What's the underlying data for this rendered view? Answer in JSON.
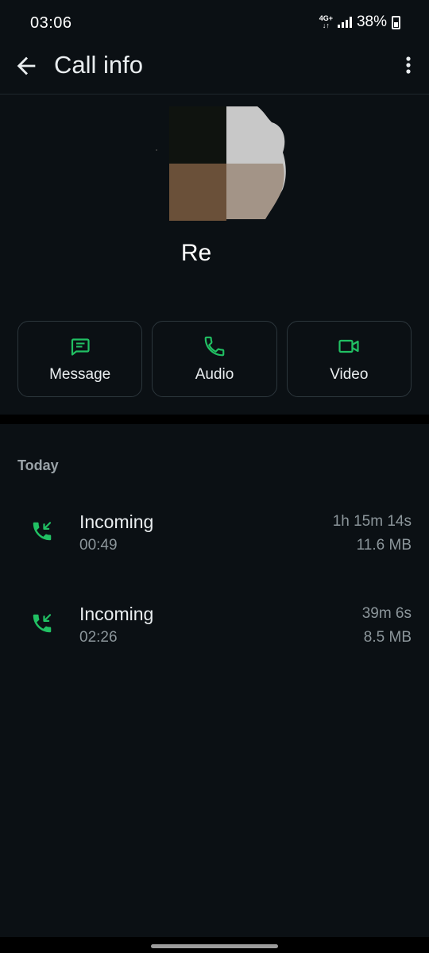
{
  "status_bar": {
    "time": "03:06",
    "network_top": "4G+",
    "network_bottom": "↓↑",
    "battery": "38%"
  },
  "app_bar": {
    "title": "Call info",
    "back_icon": "arrow-back-icon",
    "menu_icon": "more-vert-icon"
  },
  "contact": {
    "name": "Re"
  },
  "actions": [
    {
      "label": "Message",
      "icon": "message-icon"
    },
    {
      "label": "Audio",
      "icon": "phone-icon"
    },
    {
      "label": "Video",
      "icon": "videocam-icon"
    }
  ],
  "calls": {
    "section_label": "Today",
    "items": [
      {
        "type": "Incoming",
        "time": "00:49",
        "duration": "1h 15m 14s",
        "size": "11.6 MB",
        "icon": "incoming-call-icon"
      },
      {
        "type": "Incoming",
        "time": "02:26",
        "duration": "39m 6s",
        "size": "8.5 MB",
        "icon": "incoming-call-icon"
      }
    ]
  },
  "colors": {
    "accent": "#21c063",
    "background": "#0b1014",
    "text_primary": "#e9edef",
    "text_secondary": "#8c969b"
  }
}
